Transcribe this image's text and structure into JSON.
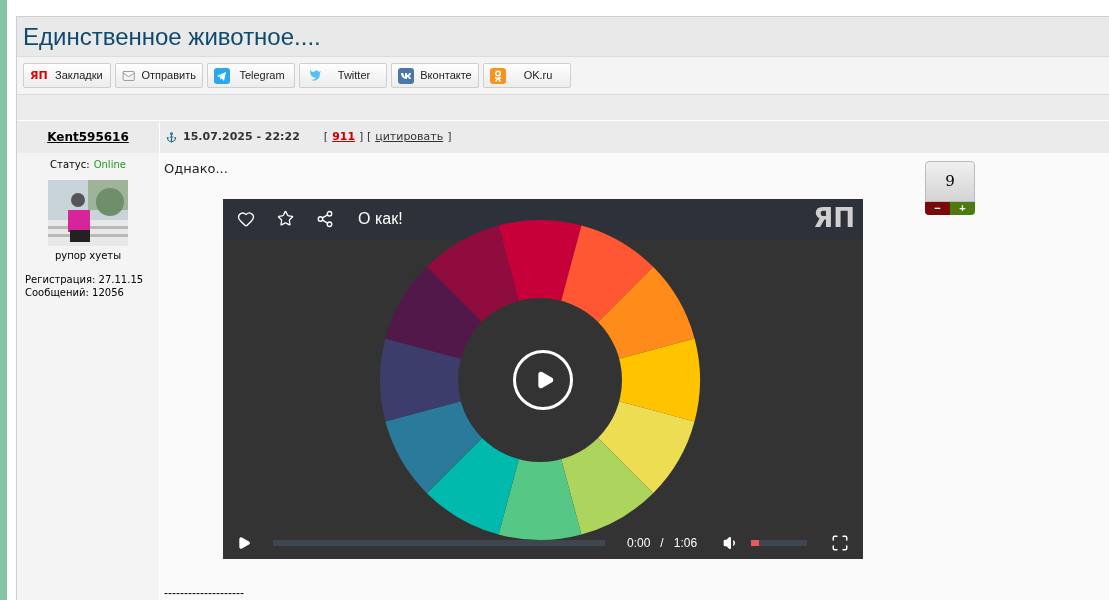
{
  "title": "Единственное животное....",
  "share_buttons": [
    {
      "kind": "yap",
      "icon_text": "ЯП",
      "label": "Закладки"
    },
    {
      "kind": "mail",
      "label": "Отправить"
    },
    {
      "kind": "telegram",
      "label": "Telegram"
    },
    {
      "kind": "twitter",
      "label": "Twitter"
    },
    {
      "kind": "vk",
      "label": "Вконтакте"
    },
    {
      "kind": "ok",
      "label": "OK.ru"
    }
  ],
  "post": {
    "author": "Kent595616",
    "status_label": "Статус:",
    "status": "Online",
    "user_title": "рупор хуеты",
    "registration": "Регистрация: 27.11.15",
    "messages": "Сообщений: 12056",
    "date": "15.07.2025 - 22:22",
    "bracket_open": "[",
    "post_number": "911",
    "bracket_mid": "] [",
    "quote": "цитировать",
    "bracket_close": "]",
    "text": "Однако...",
    "signature": "--------------------",
    "rating": "9",
    "rating_minus": "−",
    "rating_plus": "+"
  },
  "video": {
    "title": "О как!",
    "logo": "ЯП",
    "time": "0:00",
    "separator": "/",
    "duration": "1:06",
    "volume": {
      "level": 0.15
    }
  }
}
